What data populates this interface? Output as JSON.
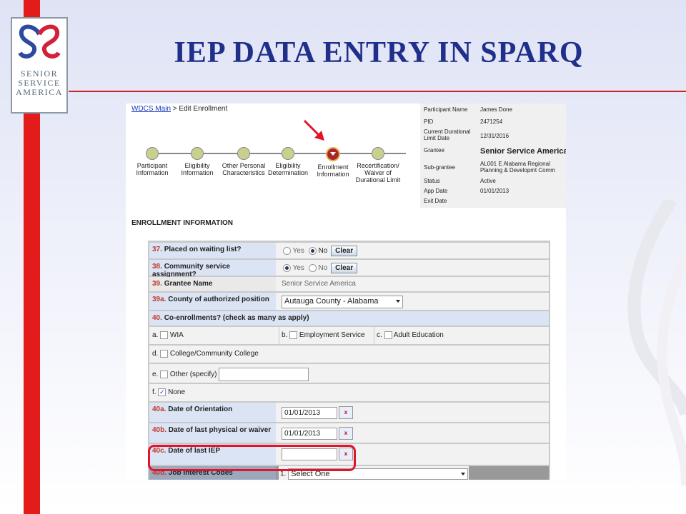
{
  "slide": {
    "title": "IEP DATA ENTRY IN SPARQ",
    "logo_lines": [
      "SENIOR",
      "SERVICE",
      "AMERICA"
    ],
    "accent": "#e31b1b",
    "title_color": "#1f2f8a"
  },
  "breadcrumb": {
    "link": "WDCS Main",
    "sep": ">",
    "current": "Edit Enrollment"
  },
  "steps": [
    {
      "label": "Participant Information"
    },
    {
      "label": "Eligibility Information"
    },
    {
      "label": "Other Personal Characteristics"
    },
    {
      "label": "Eligibility Determination"
    },
    {
      "label": "Enrollment Information"
    },
    {
      "label": "Recertification/ Waiver of Durational Limit"
    }
  ],
  "participant": {
    "name_k": "Participant Name",
    "name_v": "James Done",
    "pid_k": "PID",
    "pid_v": "2471254",
    "limit_k": "Current Durational Limit Date",
    "limit_v": "12/31/2016",
    "grantee_k": "Grantee",
    "grantee_v": "Senior Service America",
    "sub_k": "Sub-grantee",
    "sub_v": "AL001 E Alabama Regional Planning & Developmt Comm",
    "status_k": "Status",
    "status_v": "Active",
    "app_k": "App Date",
    "app_v": "01/01/2013",
    "exit_k": "Exit Date",
    "exit_v": ""
  },
  "section_title": "ENROLLMENT INFORMATION",
  "form": {
    "q37": {
      "num": "37.",
      "label": "Placed on waiting list?"
    },
    "q38": {
      "num": "38.",
      "label": "Community service assignment?"
    },
    "yes": "Yes",
    "no": "No",
    "clear": "Clear",
    "q39": {
      "num": "39.",
      "label": "Grantee Name",
      "value": "Senior Service America"
    },
    "q39a": {
      "num": "39a.",
      "label": "County of authorized position",
      "value": "Autauga County - Alabama"
    },
    "q40": {
      "num": "40.",
      "label": "Co-enrollments? (check as many as apply)"
    },
    "opt_a": {
      "k": "a.",
      "label": "WIA"
    },
    "opt_b": {
      "k": "b.",
      "label": "Employment Service"
    },
    "opt_c": {
      "k": "c.",
      "label": "Adult Education"
    },
    "opt_d": {
      "k": "d.",
      "label": "College/Community College"
    },
    "opt_e": {
      "k": "e.",
      "label": "Other (specify)"
    },
    "opt_f": {
      "k": "f.",
      "label": "None"
    },
    "q40a": {
      "num": "40a.",
      "label": "Date of Orientation",
      "value": "01/01/2013"
    },
    "q40b": {
      "num": "40b.",
      "label": "Date of last physical or waiver",
      "value": "01/01/2013"
    },
    "q40c": {
      "num": "40c.",
      "label": "Date of last IEP",
      "value": ""
    },
    "q40d": {
      "num": "40d.",
      "label": "Job Interest Codes",
      "idx": "1.",
      "value": "Select One"
    }
  }
}
